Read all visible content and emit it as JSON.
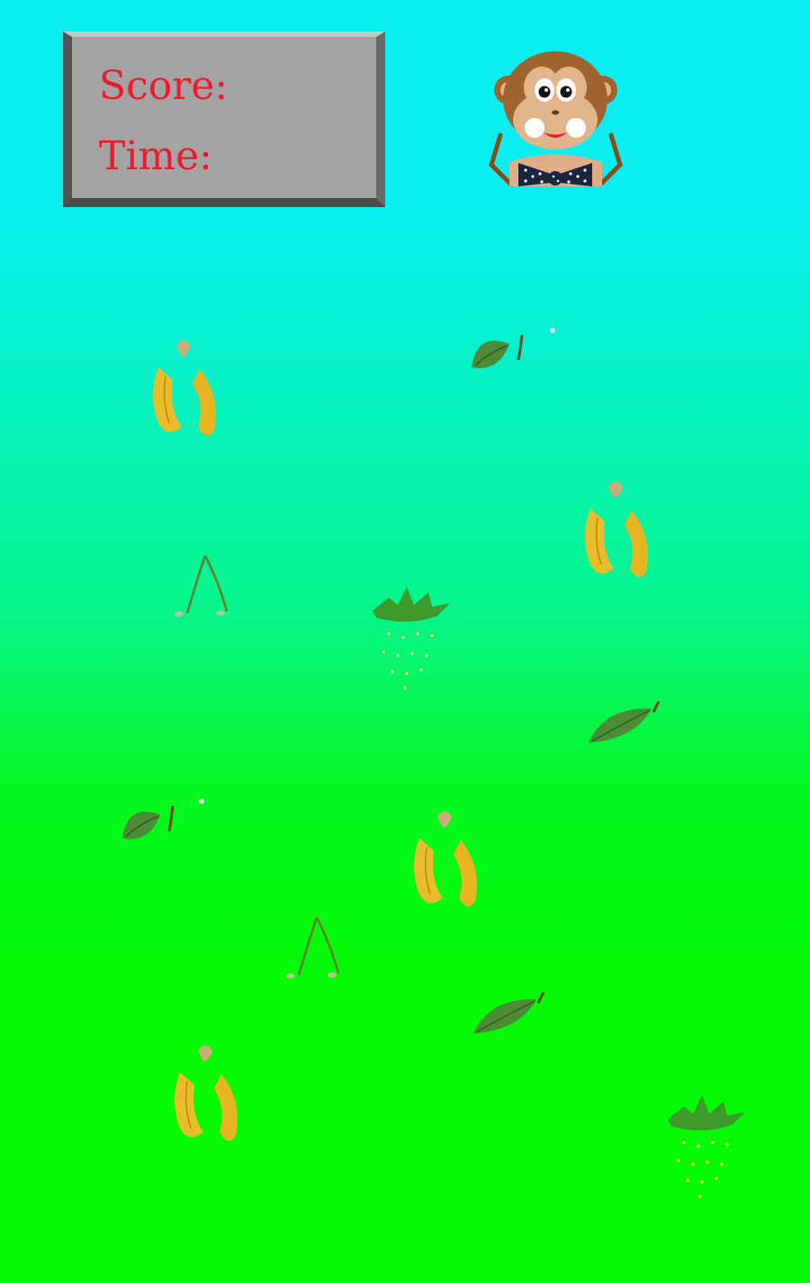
{
  "hud": {
    "score_label": "Score:",
    "time_label": "Time:"
  },
  "colors": {
    "sky_top": "#0aeef2",
    "grass_bottom": "#04fa05",
    "hud_panel": "#a3a3a3",
    "hud_text": "#ee1a2e"
  },
  "player": {
    "icon": "monkey-icon"
  },
  "fruits": [
    {
      "kind": "banana"
    },
    {
      "kind": "pear"
    },
    {
      "kind": "banana"
    },
    {
      "kind": "cherry"
    },
    {
      "kind": "strawberry"
    },
    {
      "kind": "orange"
    },
    {
      "kind": "pear"
    },
    {
      "kind": "banana"
    },
    {
      "kind": "cherry"
    },
    {
      "kind": "orange"
    },
    {
      "kind": "banana"
    },
    {
      "kind": "strawberry"
    }
  ]
}
